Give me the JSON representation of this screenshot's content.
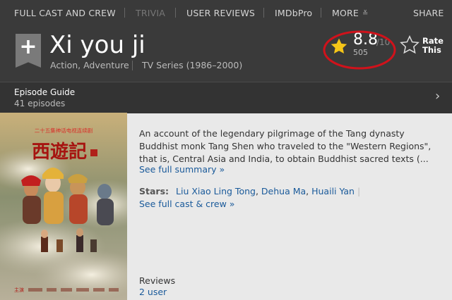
{
  "nav": {
    "full_cast": "FULL CAST AND CREW",
    "trivia": "TRIVIA",
    "user_reviews": "USER REVIEWS",
    "imdbpro": "IMDbPro",
    "more": "MORE",
    "share": "SHARE"
  },
  "title": {
    "name": "Xi you ji",
    "genres": "Action, Adventure",
    "series_info": "TV Series (1986–2000)"
  },
  "rating": {
    "value": "8.8",
    "max": "/10",
    "count": "505",
    "rate_label_1": "Rate",
    "rate_label_2": "This",
    "star_color": "#f5c518",
    "highlight_color": "#d0121b"
  },
  "episode_guide": {
    "title": "Episode Guide",
    "count": "41 episodes"
  },
  "summary": {
    "text": "An account of the legendary pilgrimage of the Tang dynasty Buddhist monk Tang Shen who traveled to the \"Western Regions\", that is, Central Asia and India, to obtain Buddhist sacred texts (...",
    "see_full": "See full summary »"
  },
  "stars": {
    "label": "Stars:",
    "names": [
      "Liu Xiao Ling Tong",
      "Dehua Ma",
      "Huaili Yan"
    ],
    "see_full_cast": "See full cast & crew »"
  },
  "reviews": {
    "label": "Reviews",
    "user": "2 user"
  },
  "poster": {
    "title_art": "西遊記",
    "top_caption": "二十五集神话电视连续剧",
    "credits": "主演"
  }
}
